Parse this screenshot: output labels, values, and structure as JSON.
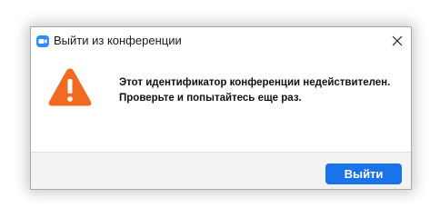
{
  "window": {
    "title": "Выйти из конференции",
    "app_icon": "zoom-camera-icon",
    "close_icon": "close-icon"
  },
  "message": {
    "icon": "warning-triangle-icon",
    "line1": "Этот идентификатор конференции недействителен.",
    "line2": "Проверьте и попытайтесь еще раз."
  },
  "footer": {
    "exit_label": "Выйти"
  },
  "colors": {
    "accent": "#1a73e8",
    "warning": "#f26a21",
    "app_icon": "#2d8cff"
  }
}
